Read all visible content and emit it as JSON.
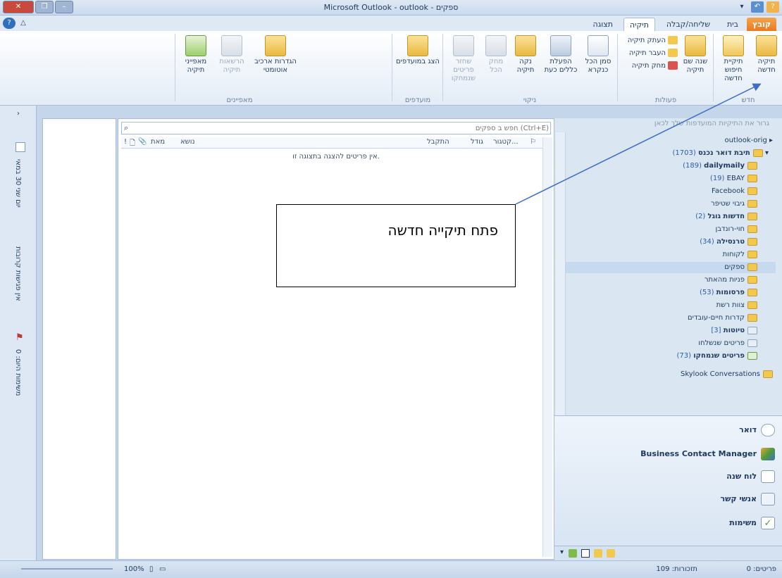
{
  "window": {
    "title": "Microsoft Outlook - outlook - ספקים"
  },
  "ribbon_tabs": [
    {
      "label": "קובץ"
    },
    {
      "label": "בית"
    },
    {
      "label": "שליחה/קבלה"
    },
    {
      "label": "תיקיה"
    },
    {
      "label": "תצוגה"
    }
  ],
  "ribbon": {
    "new_group": {
      "label": "חדש",
      "new_folder": "תיקיה חדשה",
      "new_search_folder": "תיקיית חיפוש חדשה"
    },
    "actions_group": {
      "label": "פעולות",
      "rename_folder": "שנה שם תיקיה",
      "copy_folder": "העתק תיקיה",
      "move_folder": "העבר תיקיה",
      "delete_folder": "מחק תיקיה"
    },
    "cleanup_group": {
      "label": "ניקוי",
      "mark_all_read": "סמן הכל כנקרא",
      "run_rules": "הפעלת כללים כעת",
      "clean_up_folder": "נקה תיקיה",
      "delete_all": "מחק הכל",
      "recover_deleted": "שחזר פריטים שנמחקו"
    },
    "favorites_group": {
      "label": "מועדפים",
      "show_in_favorites": "הצג במועדפים"
    },
    "properties_group": {
      "label": "מאפיינים",
      "autoarchive": "הגדרות ארכיב אוטומטי",
      "folder_permissions": "הרשאות תיקיה",
      "folder_properties": "מאפייני תיקיה"
    }
  },
  "folder_pane_header": "גרור את התיקיות המועדפות שלך לכאן",
  "folders": {
    "root": "outlook-orig",
    "items": [
      {
        "name": "תיבת דואר נכנס",
        "count": "(1703)",
        "bold": true
      },
      {
        "name": "dailymaily",
        "count": "(189)",
        "bold": true
      },
      {
        "name": "EBAY",
        "count": "(19)",
        "bold": false
      },
      {
        "name": "Facebook",
        "count": "",
        "bold": false
      },
      {
        "name": "גיבוי שטיפר",
        "count": "",
        "bold": false
      },
      {
        "name": "חדשות גוגל",
        "count": "(2)",
        "bold": true
      },
      {
        "name": "חוי-רונדבן",
        "count": "",
        "bold": false
      },
      {
        "name": "טרנסילה",
        "count": "(34)",
        "bold": true
      },
      {
        "name": "לקוחות",
        "count": "",
        "bold": false
      },
      {
        "name": "ספקים",
        "count": "",
        "bold": false,
        "selected": true
      },
      {
        "name": "פניות מהאתר",
        "count": "",
        "bold": false
      },
      {
        "name": "פרסומות",
        "count": "(53)",
        "bold": true
      },
      {
        "name": "צוות רשת",
        "count": "",
        "bold": false
      },
      {
        "name": "קדרות חיים-עובדים",
        "count": "",
        "bold": false
      },
      {
        "name": "טיוטות",
        "count": "[3]",
        "bold": true
      },
      {
        "name": "פריטים שנשלחו",
        "count": "",
        "bold": false
      },
      {
        "name": "פריטים שנמחקו",
        "count": "(73)",
        "bold": true
      },
      {
        "name": "Skylook Conversations",
        "count": "",
        "bold": false
      }
    ]
  },
  "nav_buttons": [
    {
      "label": "דואר"
    },
    {
      "label": "Business Contact Manager"
    },
    {
      "label": "לוח שנה"
    },
    {
      "label": "אנשי קשר"
    },
    {
      "label": "משימות"
    }
  ],
  "message_list": {
    "search_placeholder": "חפש ב ספקים (Ctrl+E)",
    "columns": {
      "importance": "!",
      "icon": "🗋",
      "attachment": "📎",
      "from": "מאת",
      "subject": "נושא",
      "received": "התקבל",
      "size": "גודל",
      "category": "קטגור...",
      "flag": "⚐"
    },
    "empty_message": "אין פריטים להצגה בתצוגה זו."
  },
  "left_nav": {
    "calendar_text": "יום שני 30 במאי",
    "todo_text": "אין פגישות קרובות",
    "tasks_text": "משימות היום: 0"
  },
  "status_bar": {
    "items_label": "פריטים: 0",
    "reminders_label": "תזכורות: 109",
    "zoom": "100%"
  },
  "annotation": {
    "text": "פתח תיקייה חדשה"
  }
}
